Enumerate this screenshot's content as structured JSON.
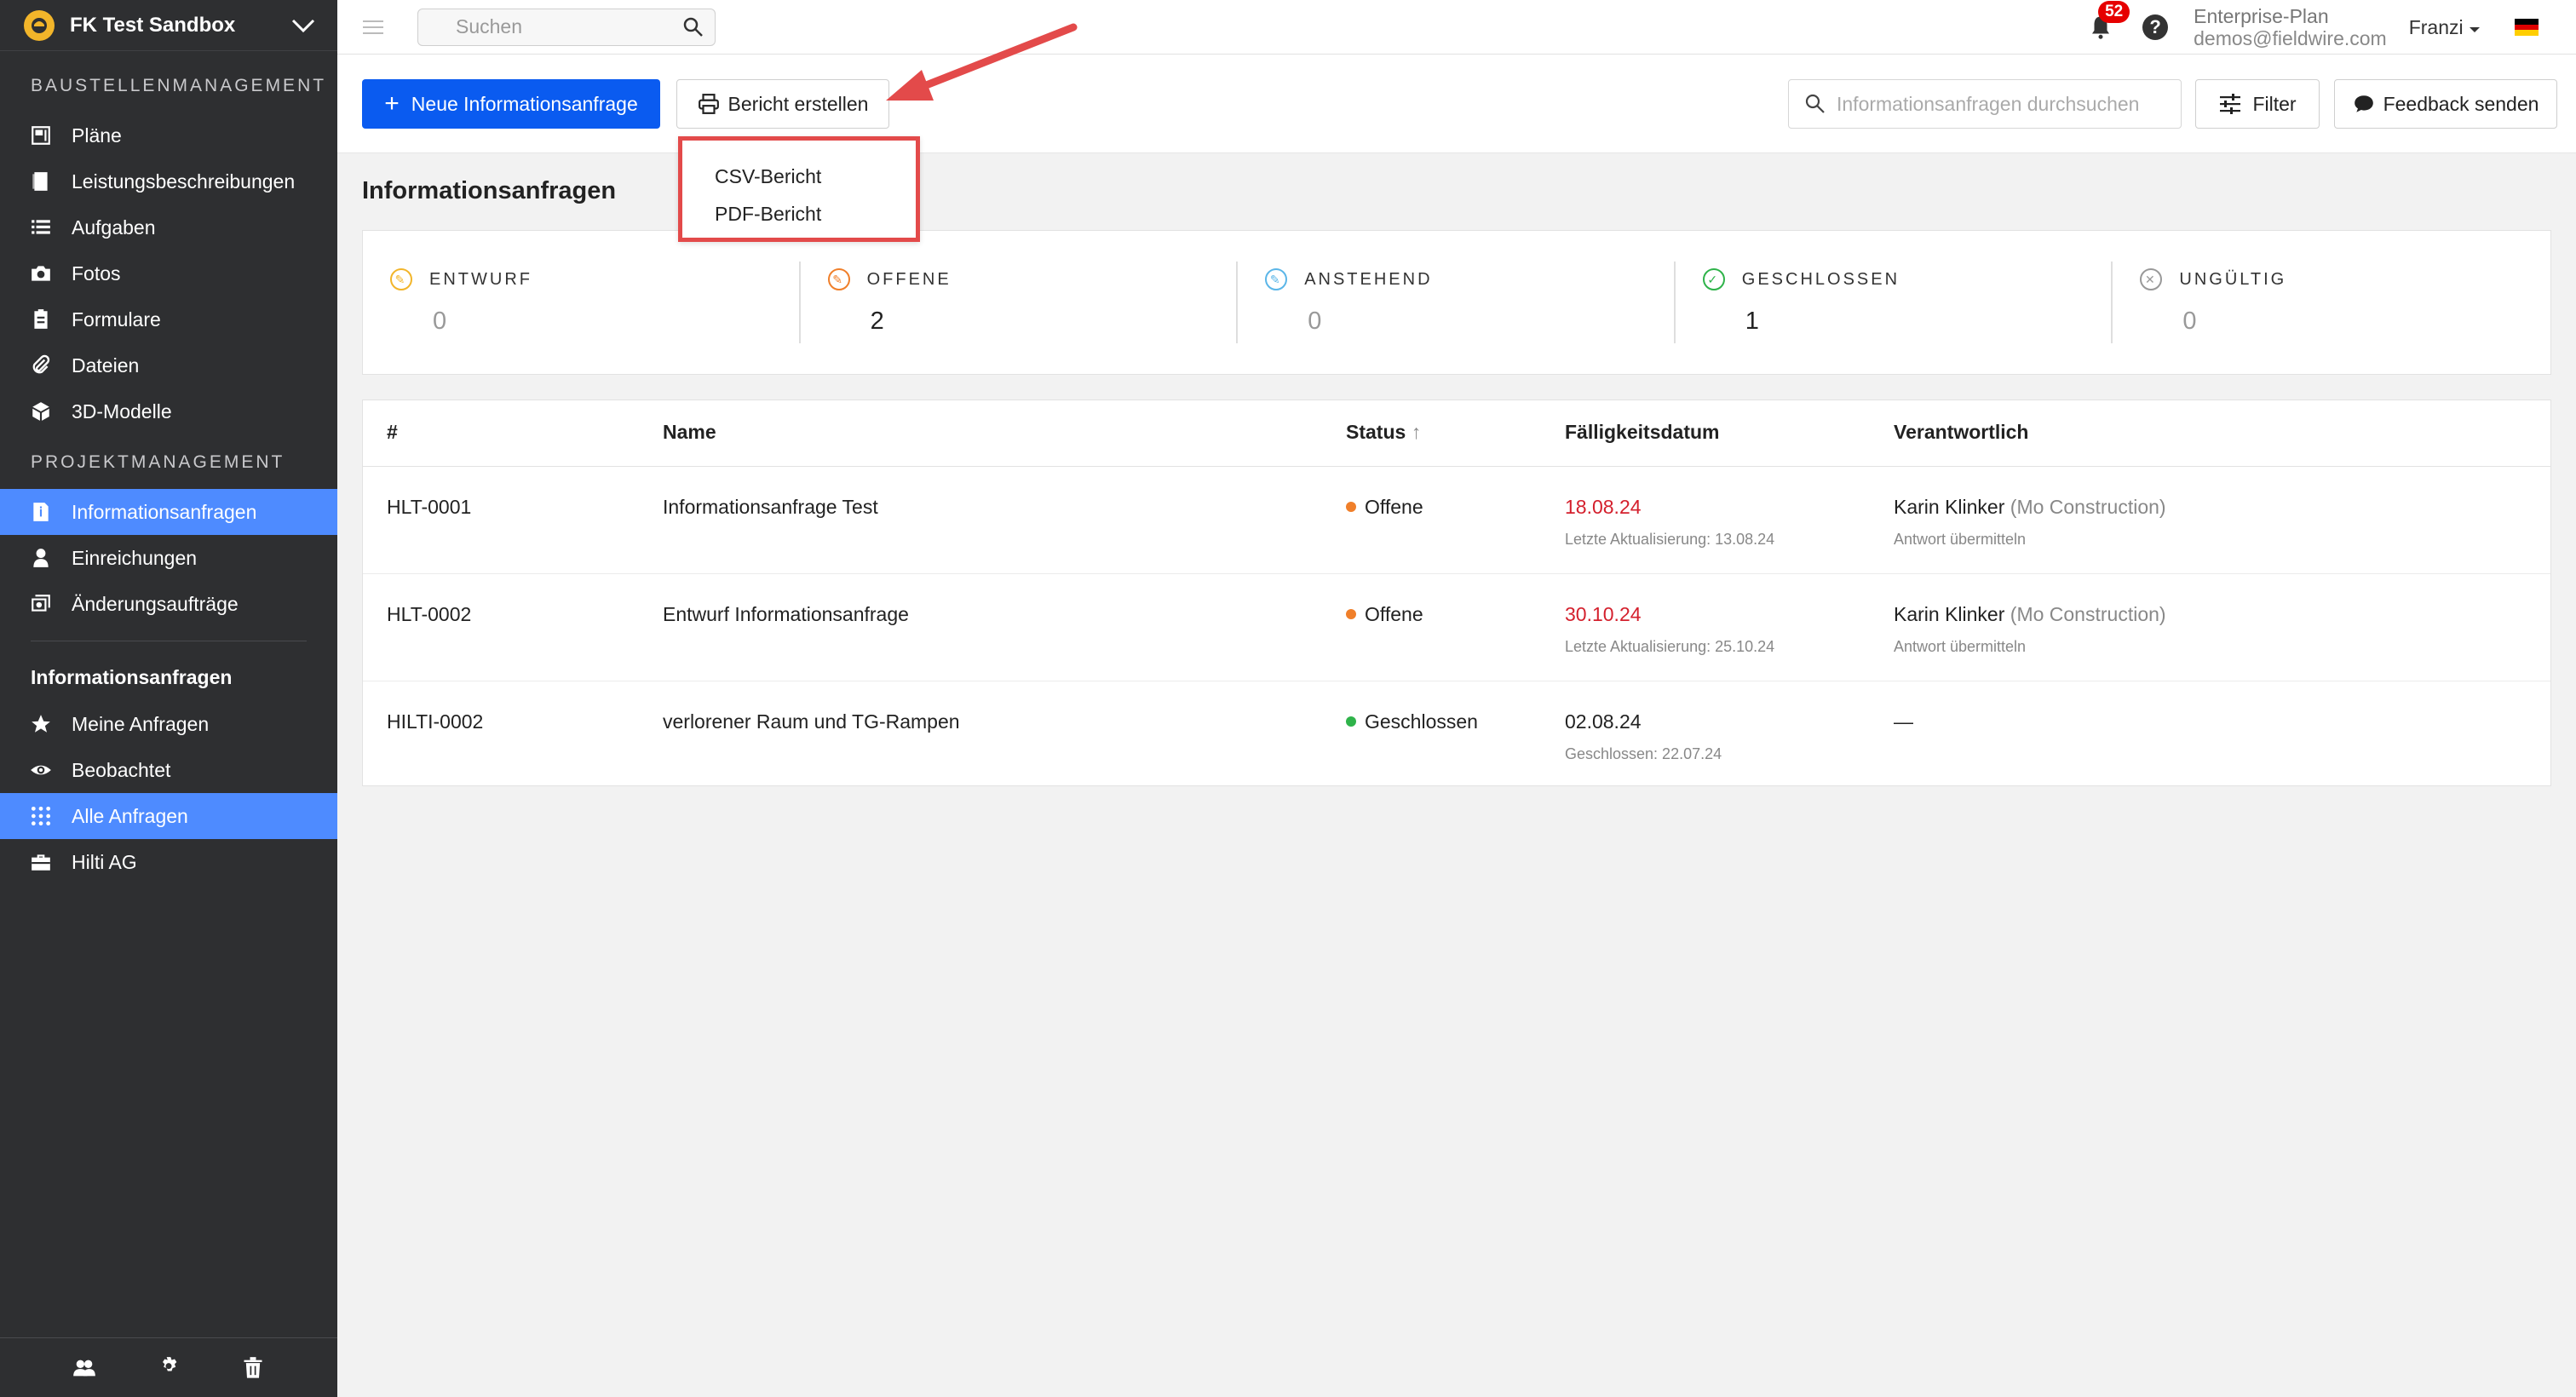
{
  "sidebar": {
    "project_name": "FK Test Sandbox",
    "section_site": "BAUSTELLENMANAGEMENT",
    "site_items": [
      {
        "label": "Pläne",
        "icon": "plans-icon"
      },
      {
        "label": "Leistungsbeschreibungen",
        "icon": "specs-icon"
      },
      {
        "label": "Aufgaben",
        "icon": "tasks-icon"
      },
      {
        "label": "Fotos",
        "icon": "camera-icon"
      },
      {
        "label": "Formulare",
        "icon": "forms-icon"
      },
      {
        "label": "Dateien",
        "icon": "paperclip-icon"
      },
      {
        "label": "3D-Modelle",
        "icon": "cube-icon"
      }
    ],
    "section_project": "PROJEKTMANAGEMENT",
    "project_items": [
      {
        "label": "Informationsanfragen",
        "icon": "rfi-icon",
        "active": true
      },
      {
        "label": "Einreichungen",
        "icon": "submittal-icon"
      },
      {
        "label": "Änderungsaufträge",
        "icon": "change-order-icon"
      }
    ],
    "sub_title": "Informationsanfragen",
    "sub_items": [
      {
        "label": "Meine Anfragen",
        "icon": "star-icon"
      },
      {
        "label": "Beobachtet",
        "icon": "eye-icon"
      },
      {
        "label": "Alle Anfragen",
        "icon": "grid-icon",
        "active": true
      },
      {
        "label": "Hilti AG",
        "icon": "briefcase-icon"
      }
    ]
  },
  "topbar": {
    "search_placeholder": "Suchen",
    "notification_count": "52",
    "help": "?",
    "plan_name": "Enterprise-Plan",
    "plan_email": "demos@fieldwire.com",
    "user_name": "Franzi"
  },
  "toolbar": {
    "new_label": "Neue Informationsanfrage",
    "report_label": "Bericht erstellen",
    "search_placeholder": "Informationsanfragen durchsuchen",
    "filter_label": "Filter",
    "feedback_label": "Feedback senden"
  },
  "report_menu": {
    "options": [
      "CSV-Bericht",
      "PDF-Bericht"
    ]
  },
  "page_title": "Informationsanfragen",
  "stats": [
    {
      "label": "ENTWURF",
      "value": "0",
      "color": "#f2b52a"
    },
    {
      "label": "OFFENE",
      "value": "2",
      "color": "#f07f2a"
    },
    {
      "label": "ANSTEHEND",
      "value": "0",
      "color": "#5bb6e8"
    },
    {
      "label": "GESCHLOSSEN",
      "value": "1",
      "color": "#2fb34a"
    },
    {
      "label": "UNGÜLTIG",
      "value": "0",
      "color": "#999999"
    }
  ],
  "table": {
    "headers": {
      "id": "#",
      "name": "Name",
      "status": "Status",
      "due": "Fälligkeitsdatum",
      "owner": "Verantwortlich"
    },
    "rows": [
      {
        "id": "HLT-0001",
        "name": "Informationsanfrage Test",
        "status": "Offene",
        "status_color": "#f07f2a",
        "due": "18.08.24",
        "due_sub": "Letzte Aktualisierung: 13.08.24",
        "owner": "Karin Klinker",
        "company": "(Mo Construction)",
        "owner_sub": "Antwort übermitteln"
      },
      {
        "id": "HLT-0002",
        "name": "Entwurf Informationsanfrage",
        "status": "Offene",
        "status_color": "#f07f2a",
        "due": "30.10.24",
        "due_sub": "Letzte Aktualisierung: 25.10.24",
        "owner": "Karin Klinker",
        "company": "(Mo Construction)",
        "owner_sub": "Antwort übermitteln"
      },
      {
        "id": "HILTI-0002",
        "name": "verlorener Raum und TG-Rampen",
        "status": "Geschlossen",
        "status_color": "#2fb34a",
        "due": "02.08.24",
        "due_sub": "Geschlossen: 22.07.24",
        "owner": "—",
        "company": "",
        "owner_sub": ""
      }
    ]
  },
  "colors": {
    "accent": "#0a5bf0",
    "sidebar_bg": "#2e2f31",
    "active_item": "#4e8bff",
    "annotation": "#e34a4a"
  }
}
